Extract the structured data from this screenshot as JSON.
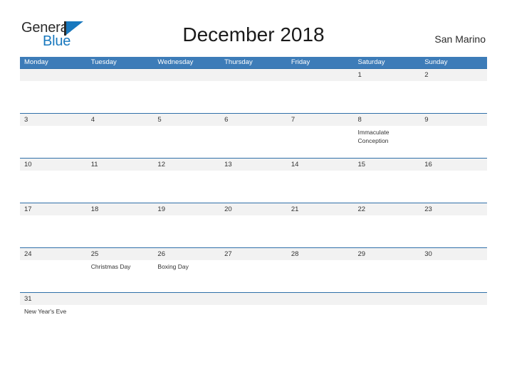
{
  "brand": {
    "name_part1": "General",
    "name_part2": "Blue",
    "flag_color": "#1878be",
    "text_color": "#2b2b2b"
  },
  "header": {
    "title": "December 2018",
    "location": "San Marino"
  },
  "colors": {
    "header_bar": "#3d7cb8",
    "row_separator": "#2f6fa8",
    "daynum_band": "#f2f2f2",
    "page_background": "#ffffff"
  },
  "calendar": {
    "month": "December",
    "year": "2018",
    "weekday_headers": [
      "Monday",
      "Tuesday",
      "Wednesday",
      "Thursday",
      "Friday",
      "Saturday",
      "Sunday"
    ],
    "weeks": [
      {
        "days": [
          {
            "number": "",
            "event": ""
          },
          {
            "number": "",
            "event": ""
          },
          {
            "number": "",
            "event": ""
          },
          {
            "number": "",
            "event": ""
          },
          {
            "number": "",
            "event": ""
          },
          {
            "number": "1",
            "event": ""
          },
          {
            "number": "2",
            "event": ""
          }
        ]
      },
      {
        "days": [
          {
            "number": "3",
            "event": ""
          },
          {
            "number": "4",
            "event": ""
          },
          {
            "number": "5",
            "event": ""
          },
          {
            "number": "6",
            "event": ""
          },
          {
            "number": "7",
            "event": ""
          },
          {
            "number": "8",
            "event": "Immaculate Conception"
          },
          {
            "number": "9",
            "event": ""
          }
        ]
      },
      {
        "days": [
          {
            "number": "10",
            "event": ""
          },
          {
            "number": "11",
            "event": ""
          },
          {
            "number": "12",
            "event": ""
          },
          {
            "number": "13",
            "event": ""
          },
          {
            "number": "14",
            "event": ""
          },
          {
            "number": "15",
            "event": ""
          },
          {
            "number": "16",
            "event": ""
          }
        ]
      },
      {
        "days": [
          {
            "number": "17",
            "event": ""
          },
          {
            "number": "18",
            "event": ""
          },
          {
            "number": "19",
            "event": ""
          },
          {
            "number": "20",
            "event": ""
          },
          {
            "number": "21",
            "event": ""
          },
          {
            "number": "22",
            "event": ""
          },
          {
            "number": "23",
            "event": ""
          }
        ]
      },
      {
        "days": [
          {
            "number": "24",
            "event": ""
          },
          {
            "number": "25",
            "event": "Christmas Day"
          },
          {
            "number": "26",
            "event": "Boxing Day"
          },
          {
            "number": "27",
            "event": ""
          },
          {
            "number": "28",
            "event": ""
          },
          {
            "number": "29",
            "event": ""
          },
          {
            "number": "30",
            "event": ""
          }
        ]
      },
      {
        "days": [
          {
            "number": "31",
            "event": "New Year's Eve"
          },
          {
            "number": "",
            "event": ""
          },
          {
            "number": "",
            "event": ""
          },
          {
            "number": "",
            "event": ""
          },
          {
            "number": "",
            "event": ""
          },
          {
            "number": "",
            "event": ""
          },
          {
            "number": "",
            "event": ""
          }
        ]
      }
    ]
  }
}
